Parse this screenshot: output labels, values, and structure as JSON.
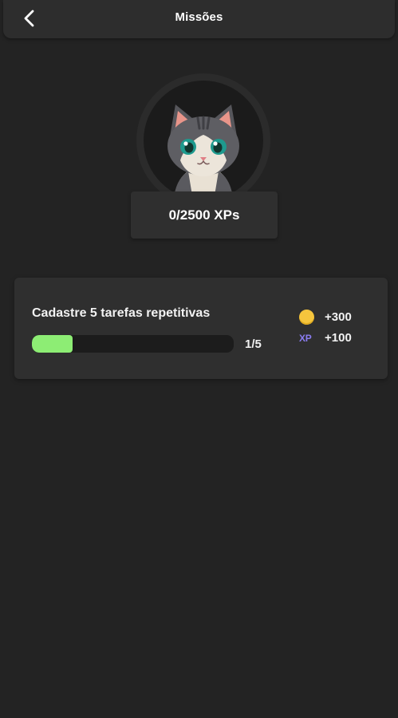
{
  "header": {
    "title": "Missões",
    "back_icon": "chevron-left-icon"
  },
  "profile": {
    "avatar_icon": "cat-avatar-icon",
    "xp_text": "0/2500 XPs"
  },
  "missions": [
    {
      "title": "Cadastre 5 tarefas repetitivas",
      "progress_text": "1/5",
      "progress_fraction": 0.2,
      "rewards": {
        "coins": "+300",
        "xp_label": "XP",
        "xp": "+100"
      }
    }
  ],
  "colors": {
    "background": "#232323",
    "surface": "#2f2f2f",
    "progress_fill": "#8ded74",
    "coin": "#f5c53d",
    "xp_accent": "#8a7cf0"
  }
}
